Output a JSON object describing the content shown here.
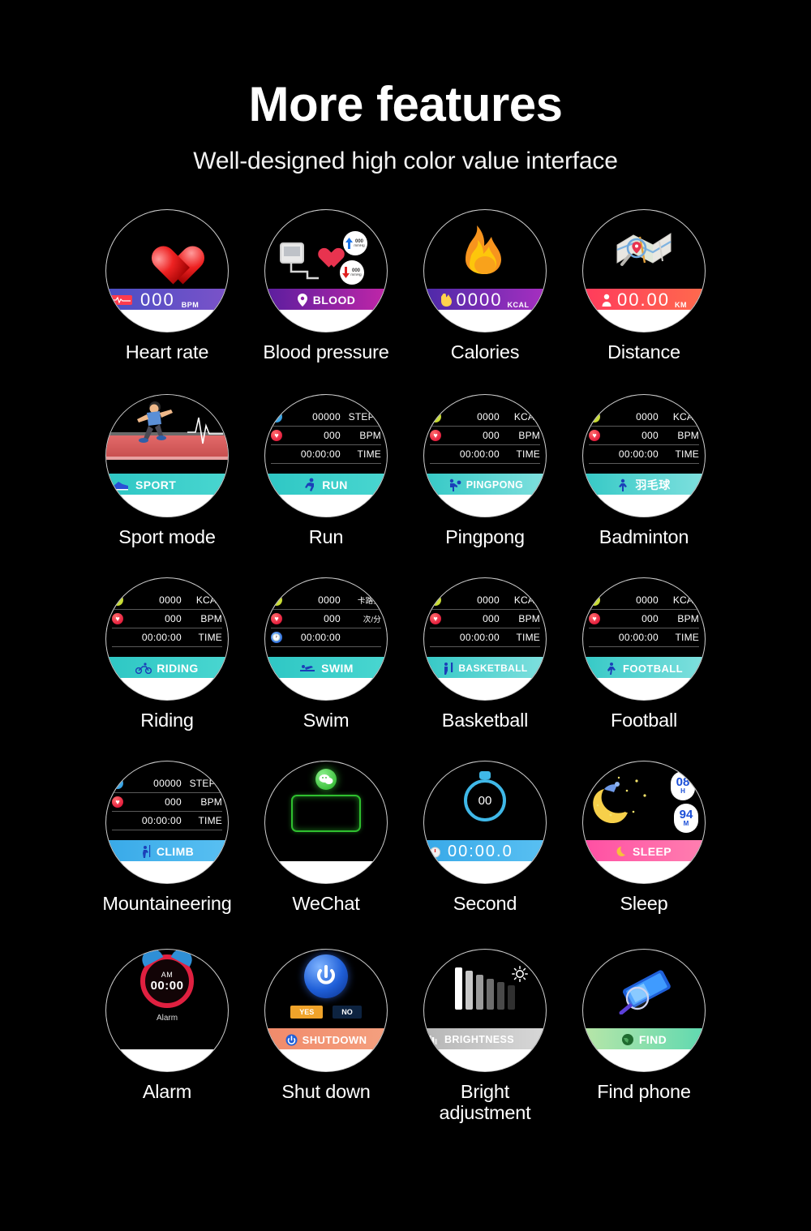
{
  "header": {
    "title": "More features",
    "subtitle": "Well-designed high color value interface"
  },
  "colors": {
    "background": "#000000",
    "text": "#ffffff",
    "heart_rate_bar": "#5a50c6",
    "blood_bar": "#8f1fa6",
    "calories_bar": "#7a2ab4",
    "distance_bar": "#ff4a57",
    "sport_teal": "#2ec7c4",
    "sleep_pink": "#ff4fa3",
    "shutdown_orange": "#f08a6a",
    "brightness_gray": "#c4c4c4",
    "find_green": "#8fdfa8",
    "second_blue": "#38a9e8"
  },
  "faces": [
    {
      "id": "heart-rate",
      "caption": "Heart rate",
      "bar_label": "",
      "value": "000",
      "unit": "BPM",
      "icon": "heart-icon"
    },
    {
      "id": "blood-pressure",
      "caption": "Blood pressure",
      "bar_label": "BLOOD",
      "badge_high": {
        "value": "000",
        "unit": "mmHg",
        "arrow": "up"
      },
      "badge_low": {
        "value": "000",
        "unit": "mmHg",
        "arrow": "down"
      },
      "icon": "blood-pressure-monitor-icon"
    },
    {
      "id": "calories",
      "caption": "Calories",
      "value": "0000",
      "unit": "KCAL",
      "icon": "flame-icon"
    },
    {
      "id": "distance",
      "caption": "Distance",
      "value": "00.00",
      "unit": "KM",
      "icon": "map-icon"
    },
    {
      "id": "sport-mode",
      "caption": "Sport mode",
      "bar_label": "SPORT",
      "icon": "running-shoes-icon"
    },
    {
      "id": "run",
      "caption": "Run",
      "bar_label": "RUN",
      "rows": [
        {
          "icon": "footsteps-icon",
          "value": "00000",
          "unit": "STEPS"
        },
        {
          "icon": "heart-icon",
          "value": "000",
          "unit": "BPM"
        },
        {
          "icon": "",
          "value": "00:00:00",
          "unit": "TIME"
        }
      ]
    },
    {
      "id": "pingpong",
      "caption": "Pingpong",
      "bar_label": "PINGPONG",
      "rows": [
        {
          "icon": "flame-icon",
          "value": "0000",
          "unit": "KCAL"
        },
        {
          "icon": "heart-icon",
          "value": "000",
          "unit": "BPM"
        },
        {
          "icon": "",
          "value": "00:00:00",
          "unit": "TIME"
        }
      ]
    },
    {
      "id": "badminton",
      "caption": "Badminton",
      "bar_label": "羽毛球",
      "rows": [
        {
          "icon": "flame-icon",
          "value": "0000",
          "unit": "KCAL"
        },
        {
          "icon": "heart-icon",
          "value": "000",
          "unit": "BPM"
        },
        {
          "icon": "",
          "value": "00:00:00",
          "unit": "TIME"
        }
      ]
    },
    {
      "id": "riding",
      "caption": "Riding",
      "bar_label": "RIDING",
      "rows": [
        {
          "icon": "flame-icon",
          "value": "0000",
          "unit": "KCAL"
        },
        {
          "icon": "heart-icon",
          "value": "000",
          "unit": "BPM"
        },
        {
          "icon": "",
          "value": "00:00:00",
          "unit": "TIME"
        }
      ]
    },
    {
      "id": "swim",
      "caption": "Swim",
      "bar_label": "SWIM",
      "rows": [
        {
          "icon": "flame-icon",
          "value": "0000",
          "unit": "卡路里"
        },
        {
          "icon": "heart-icon",
          "value": "000",
          "unit": "次/分"
        },
        {
          "icon": "clock-icon",
          "value": "00:00:00",
          "unit": ""
        }
      ]
    },
    {
      "id": "basketball",
      "caption": "Basketball",
      "bar_label": "BASKETBALL",
      "rows": [
        {
          "icon": "flame-icon",
          "value": "0000",
          "unit": "KCAL"
        },
        {
          "icon": "heart-icon",
          "value": "000",
          "unit": "BPM"
        },
        {
          "icon": "",
          "value": "00:00:00",
          "unit": "TIME"
        }
      ]
    },
    {
      "id": "football",
      "caption": "Football",
      "bar_label": "FOOTBALL",
      "rows": [
        {
          "icon": "flame-icon",
          "value": "0000",
          "unit": "KCAL"
        },
        {
          "icon": "heart-icon",
          "value": "000",
          "unit": "BPM"
        },
        {
          "icon": "",
          "value": "00:00:00",
          "unit": "TIME"
        }
      ]
    },
    {
      "id": "mountaineering",
      "caption": "Mountaineering",
      "bar_label": "CLIMB",
      "rows": [
        {
          "icon": "footsteps-icon",
          "value": "00000",
          "unit": "STEPS"
        },
        {
          "icon": "heart-icon",
          "value": "000",
          "unit": "BPM"
        },
        {
          "icon": "",
          "value": "00:00:00",
          "unit": "TIME"
        }
      ]
    },
    {
      "id": "wechat",
      "caption": "WeChat",
      "icon": "wechat-icon"
    },
    {
      "id": "second",
      "caption": "Second",
      "dial_value": "00",
      "value": "00:00.0",
      "icon": "stopwatch-icon"
    },
    {
      "id": "sleep",
      "caption": "Sleep",
      "bar_label": "SLEEP",
      "hours": {
        "value": "08",
        "unit": "H"
      },
      "minutes": {
        "value": "94",
        "unit": "M"
      },
      "icon": "moon-icon"
    },
    {
      "id": "alarm",
      "caption": "Alarm",
      "meridiem": "AM",
      "time": "00:00",
      "label": "Alarm",
      "icon": "alarm-clock-icon"
    },
    {
      "id": "shut-down",
      "caption": "Shut down",
      "bar_label": "SHUTDOWN",
      "yes": "YES",
      "no": "NO",
      "icon": "power-icon"
    },
    {
      "id": "bright-adjustment",
      "caption": "Bright\nadjustment",
      "bar_label": "BRIGHTNESS",
      "icon": "sun-icon"
    },
    {
      "id": "find-phone",
      "caption": "Find phone",
      "bar_label": "FIND",
      "icon": "magnifier-phone-icon"
    }
  ]
}
